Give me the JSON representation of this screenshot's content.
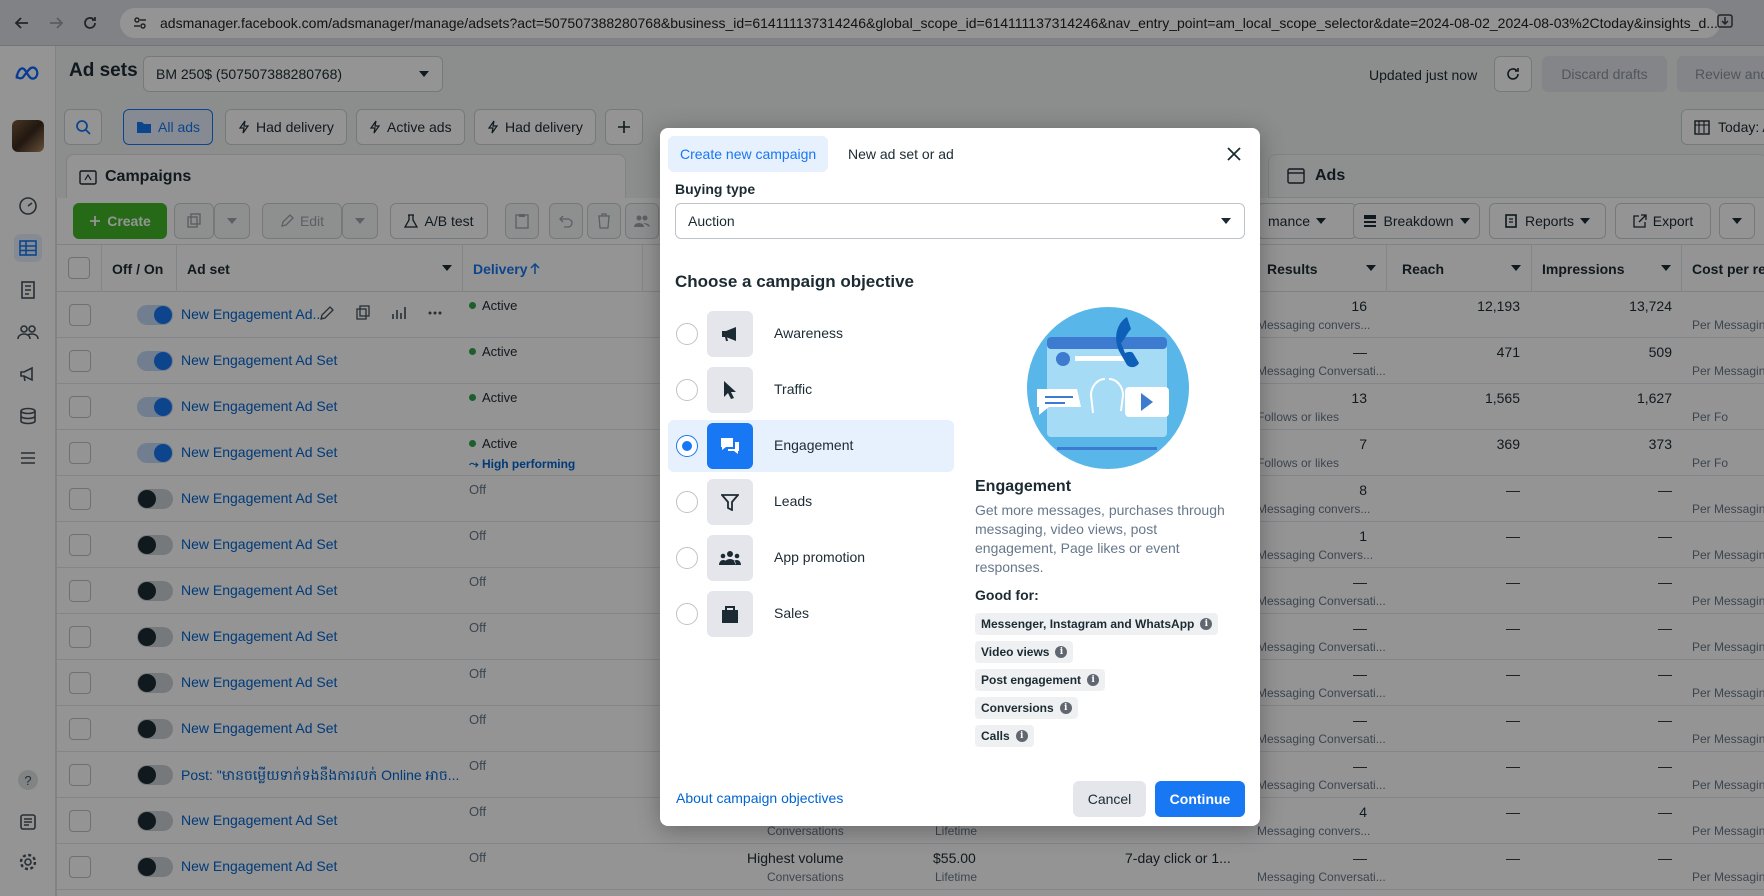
{
  "browser": {
    "url": "adsmanager.facebook.com/adsmanager/manage/adsets?act=507507388280768&business_id=614111137314246&global_scope_id=614111137314246&nav_entry_point=am_local_scope_selector&date=2024-08-02_2024-08-03%2Ctoday&insights_d..."
  },
  "header": {
    "title": "Ad sets",
    "account": "BM 250$ (507507388280768)",
    "updated": "Updated just now",
    "discard": "Discard drafts",
    "review": "Review and p"
  },
  "filters": {
    "all_ads": "All ads",
    "had_delivery_1": "Had delivery",
    "active_ads": "Active ads",
    "had_delivery_2": "Had delivery",
    "date": "Today: A"
  },
  "tabs": {
    "campaigns": "Campaigns",
    "ads": "Ads"
  },
  "toolbar": {
    "create": "Create",
    "edit": "Edit",
    "ab_test": "A/B test",
    "performance": "mance",
    "breakdown": "Breakdown",
    "reports": "Reports",
    "export": "Export"
  },
  "table": {
    "headers": {
      "off_on": "Off / On",
      "ad_set": "Ad set",
      "delivery": "Delivery",
      "results": "Results",
      "reach": "Reach",
      "impressions": "Impressions",
      "cost": "Cost per re"
    },
    "rows": [
      {
        "name": "New Engagement Ad...",
        "on": true,
        "delivery": "Active",
        "results": "16",
        "results_sub": "Messaging convers...",
        "reach": "12,193",
        "impr": "13,724",
        "cost_sub": "Per Messagin",
        "hp": ""
      },
      {
        "name": "New Engagement Ad Set",
        "on": true,
        "delivery": "Active",
        "results": "—",
        "results_sub": "Messaging Conversati...",
        "reach": "471",
        "impr": "509",
        "cost_sub": "Per Messagin",
        "hp": ""
      },
      {
        "name": "New Engagement Ad Set",
        "on": true,
        "delivery": "Active",
        "results": "13",
        "results_sub": "Follows or likes",
        "reach": "1,565",
        "impr": "1,627",
        "cost_sub": "Per Fo",
        "hp": ""
      },
      {
        "name": "New Engagement Ad Set",
        "on": true,
        "delivery": "Active",
        "results": "7",
        "results_sub": "Follows or likes",
        "reach": "369",
        "impr": "373",
        "cost_sub": "Per Fo",
        "hp": "High performing"
      },
      {
        "name": "New Engagement Ad Set",
        "on": false,
        "delivery": "Off",
        "results": "8",
        "results_sub": "Messaging convers...",
        "reach": "—",
        "impr": "—",
        "cost_sub": "Per Messagin",
        "hp": ""
      },
      {
        "name": "New Engagement Ad Set",
        "on": false,
        "delivery": "Off",
        "results": "1",
        "results_sub": "Messaging Convers...",
        "reach": "—",
        "impr": "—",
        "cost_sub": "Per Messagin",
        "hp": ""
      },
      {
        "name": "New Engagement Ad Set",
        "on": false,
        "delivery": "Off",
        "results": "—",
        "results_sub": "Messaging Conversati...",
        "reach": "—",
        "impr": "—",
        "cost_sub": "Per Messagin",
        "hp": ""
      },
      {
        "name": "New Engagement Ad Set",
        "on": false,
        "delivery": "Off",
        "results": "—",
        "results_sub": "Messaging Conversati...",
        "reach": "—",
        "impr": "—",
        "cost_sub": "Per Messagin",
        "hp": ""
      },
      {
        "name": "New Engagement Ad Set",
        "on": false,
        "delivery": "Off",
        "results": "—",
        "results_sub": "Messaging Conversati...",
        "reach": "—",
        "impr": "—",
        "cost_sub": "Per Messagin",
        "hp": ""
      },
      {
        "name": "New Engagement Ad Set",
        "on": false,
        "delivery": "Off",
        "results": "—",
        "results_sub": "Messaging Conversati...",
        "reach": "—",
        "impr": "—",
        "cost_sub": "Per Messagin",
        "hp": ""
      },
      {
        "name": "Post: \"មានចម្លើយទាក់ទងនឹងការលក់ Online អាច...",
        "on": false,
        "delivery": "Off",
        "results": "—",
        "results_sub": "Messaging Conversati...",
        "reach": "—",
        "impr": "—",
        "cost_sub": "Per Messagin",
        "hp": ""
      },
      {
        "name": "New Engagement Ad Set",
        "on": false,
        "delivery": "Off",
        "results": "4",
        "results_sub": "Messaging convers...",
        "reach": "—",
        "impr": "—",
        "cost_sub": "Per Messagin",
        "hp": ""
      },
      {
        "name": "New Engagement Ad Set",
        "on": false,
        "delivery": "Off",
        "results": "—",
        "results_sub": "Messaging Conversati...",
        "reach": "—",
        "impr": "—",
        "cost_sub": "Per Messagin",
        "hp": ""
      }
    ],
    "row12_extra": {
      "bid": "Conversations",
      "budget": "Lifetime"
    },
    "row13_extra": {
      "bid": "Highest volume",
      "bid_sub": "Conversations",
      "budget": "$55.00",
      "budget_sub": "Lifetime",
      "attr": "7-day click or 1..."
    }
  },
  "modal": {
    "tab_create": "Create new campaign",
    "tab_new": "New ad set or ad",
    "buying_type_label": "Buying type",
    "buying_type_value": "Auction",
    "choose_title": "Choose a campaign objective",
    "objectives": [
      {
        "label": "Awareness",
        "icon": "megaphone-icon"
      },
      {
        "label": "Traffic",
        "icon": "cursor-icon"
      },
      {
        "label": "Engagement",
        "icon": "chat-bubbles-icon"
      },
      {
        "label": "Leads",
        "icon": "filter-funnel-icon"
      },
      {
        "label": "App promotion",
        "icon": "people-icon"
      },
      {
        "label": "Sales",
        "icon": "shopping-bag-icon"
      }
    ],
    "selected_objective": "Engagement",
    "detail_title": "Engagement",
    "detail_desc": "Get more messages, purchases through messaging, video views, post engagement, Page likes or event responses.",
    "good_for_label": "Good for:",
    "good_for": [
      "Messenger, Instagram and WhatsApp",
      "Video views",
      "Post engagement",
      "Conversions",
      "Calls"
    ],
    "about_link": "About campaign objectives",
    "cancel": "Cancel",
    "continue": "Continue"
  },
  "colors": {
    "accent": "#1877f2",
    "create_green": "#42b72a",
    "link": "#0064d1"
  }
}
